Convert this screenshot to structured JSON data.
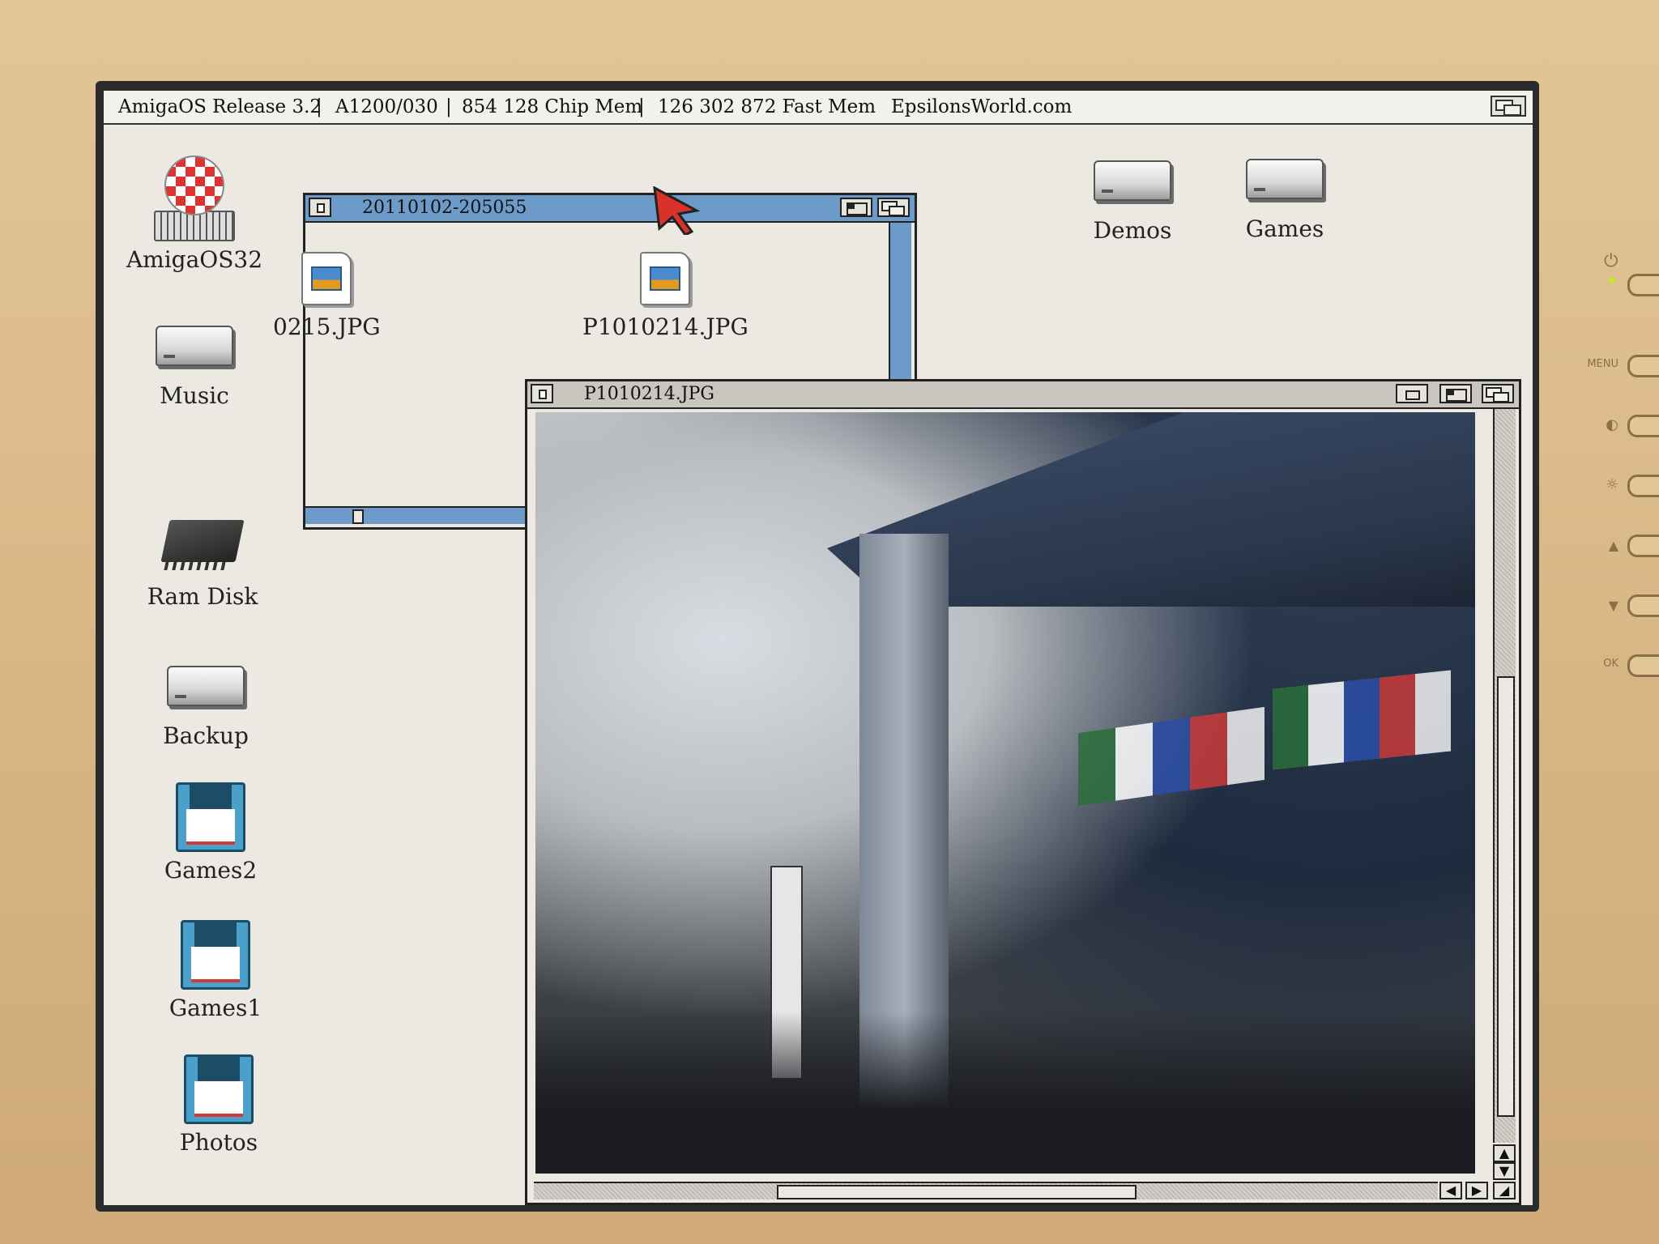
{
  "screen_title": {
    "release": "AmigaOS Release 3.2",
    "model": "A1200/030",
    "chip_mem": "854 128 Chip Mem",
    "fast_mem": "126 302 872 Fast Mem",
    "site": "EpsilonsWorld.com"
  },
  "desktop_icons": [
    {
      "label": "AmigaOS32",
      "kind": "system-drive"
    },
    {
      "label": "Music",
      "kind": "hard-drive"
    },
    {
      "label": "Ram Disk",
      "kind": "ram-disk"
    },
    {
      "label": "Backup",
      "kind": "hard-drive"
    },
    {
      "label": "Games2",
      "kind": "floppy"
    },
    {
      "label": "Games1",
      "kind": "floppy"
    },
    {
      "label": "Photos",
      "kind": "floppy"
    },
    {
      "label": "Demos",
      "kind": "hard-drive"
    },
    {
      "label": "Games",
      "kind": "hard-drive"
    }
  ],
  "drawer_window": {
    "title": "20110102-205055",
    "files": [
      {
        "label": "0215.JPG"
      },
      {
        "label": "P1010214.JPG"
      }
    ]
  },
  "image_window": {
    "title": "P1010214.JPG"
  },
  "monitor_panel": {
    "labels": [
      "MENU",
      "OK"
    ]
  },
  "colors": {
    "active_title": "#6d9bc9",
    "desktop": "#ece9e2",
    "bezel": "#d8b684"
  }
}
